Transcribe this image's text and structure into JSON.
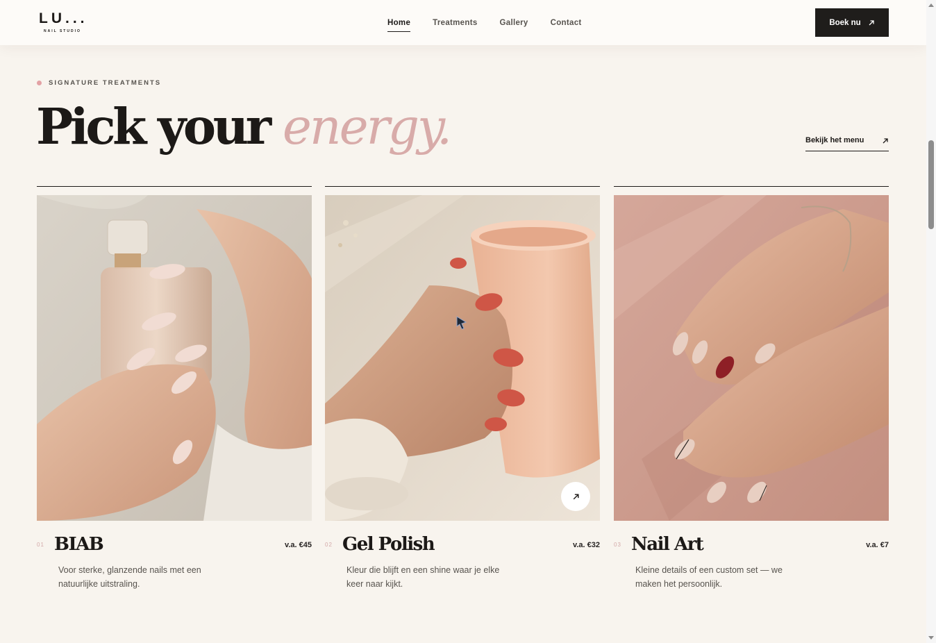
{
  "header": {
    "logo_main": "LU...",
    "logo_sub": "NAIL STUDIO",
    "nav": [
      {
        "label": "Home",
        "active": true
      },
      {
        "label": "Treatments",
        "active": false
      },
      {
        "label": "Gallery",
        "active": false
      },
      {
        "label": "Contact",
        "active": false
      }
    ],
    "cta_label": "Boek nu",
    "cta_icon": "arrow-up-right-icon"
  },
  "hero": {
    "eyebrow": "SIGNATURE TREATMENTS",
    "headline_plain": "Pick your",
    "headline_accent": "energy.",
    "menu_link": "Bekijk het menu",
    "accent_color": "#d8aba9",
    "eyebrow_dot_color": "#e3a2a5"
  },
  "cards": [
    {
      "num": "01",
      "title": "BIAB",
      "price": "v.a. €45",
      "desc": "Voor sterke, glanzende nails met een natuurlijke uitstraling.",
      "image": "hands-holding-perfume-bottle"
    },
    {
      "num": "02",
      "title": "Gel Polish",
      "price": "v.a. €32",
      "desc": "Kleur die blijft en een shine waar je elke keer naar kijkt.",
      "image": "hand-holding-peach-mug"
    },
    {
      "num": "03",
      "title": "Nail Art",
      "price": "v.a. €7",
      "desc": "Kleine details of een custom set — we maken het persoonlijk.",
      "image": "hands-with-nail-art"
    }
  ]
}
